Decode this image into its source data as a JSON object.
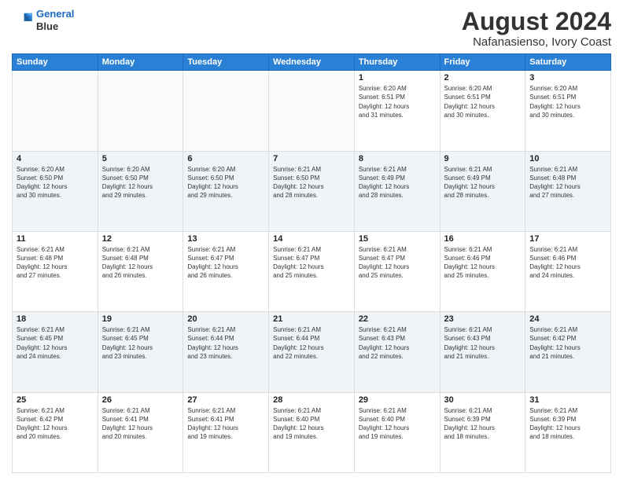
{
  "header": {
    "logo_line1": "General",
    "logo_line2": "Blue",
    "title": "August 2024",
    "subtitle": "Nafanasienso, Ivory Coast"
  },
  "weekdays": [
    "Sunday",
    "Monday",
    "Tuesday",
    "Wednesday",
    "Thursday",
    "Friday",
    "Saturday"
  ],
  "weeks": [
    [
      {
        "day": "",
        "info": ""
      },
      {
        "day": "",
        "info": ""
      },
      {
        "day": "",
        "info": ""
      },
      {
        "day": "",
        "info": ""
      },
      {
        "day": "1",
        "info": "Sunrise: 6:20 AM\nSunset: 6:51 PM\nDaylight: 12 hours\nand 31 minutes."
      },
      {
        "day": "2",
        "info": "Sunrise: 6:20 AM\nSunset: 6:51 PM\nDaylight: 12 hours\nand 30 minutes."
      },
      {
        "day": "3",
        "info": "Sunrise: 6:20 AM\nSunset: 6:51 PM\nDaylight: 12 hours\nand 30 minutes."
      }
    ],
    [
      {
        "day": "4",
        "info": "Sunrise: 6:20 AM\nSunset: 6:50 PM\nDaylight: 12 hours\nand 30 minutes."
      },
      {
        "day": "5",
        "info": "Sunrise: 6:20 AM\nSunset: 6:50 PM\nDaylight: 12 hours\nand 29 minutes."
      },
      {
        "day": "6",
        "info": "Sunrise: 6:20 AM\nSunset: 6:50 PM\nDaylight: 12 hours\nand 29 minutes."
      },
      {
        "day": "7",
        "info": "Sunrise: 6:21 AM\nSunset: 6:50 PM\nDaylight: 12 hours\nand 28 minutes."
      },
      {
        "day": "8",
        "info": "Sunrise: 6:21 AM\nSunset: 6:49 PM\nDaylight: 12 hours\nand 28 minutes."
      },
      {
        "day": "9",
        "info": "Sunrise: 6:21 AM\nSunset: 6:49 PM\nDaylight: 12 hours\nand 28 minutes."
      },
      {
        "day": "10",
        "info": "Sunrise: 6:21 AM\nSunset: 6:48 PM\nDaylight: 12 hours\nand 27 minutes."
      }
    ],
    [
      {
        "day": "11",
        "info": "Sunrise: 6:21 AM\nSunset: 6:48 PM\nDaylight: 12 hours\nand 27 minutes."
      },
      {
        "day": "12",
        "info": "Sunrise: 6:21 AM\nSunset: 6:48 PM\nDaylight: 12 hours\nand 26 minutes."
      },
      {
        "day": "13",
        "info": "Sunrise: 6:21 AM\nSunset: 6:47 PM\nDaylight: 12 hours\nand 26 minutes."
      },
      {
        "day": "14",
        "info": "Sunrise: 6:21 AM\nSunset: 6:47 PM\nDaylight: 12 hours\nand 25 minutes."
      },
      {
        "day": "15",
        "info": "Sunrise: 6:21 AM\nSunset: 6:47 PM\nDaylight: 12 hours\nand 25 minutes."
      },
      {
        "day": "16",
        "info": "Sunrise: 6:21 AM\nSunset: 6:46 PM\nDaylight: 12 hours\nand 25 minutes."
      },
      {
        "day": "17",
        "info": "Sunrise: 6:21 AM\nSunset: 6:46 PM\nDaylight: 12 hours\nand 24 minutes."
      }
    ],
    [
      {
        "day": "18",
        "info": "Sunrise: 6:21 AM\nSunset: 6:45 PM\nDaylight: 12 hours\nand 24 minutes."
      },
      {
        "day": "19",
        "info": "Sunrise: 6:21 AM\nSunset: 6:45 PM\nDaylight: 12 hours\nand 23 minutes."
      },
      {
        "day": "20",
        "info": "Sunrise: 6:21 AM\nSunset: 6:44 PM\nDaylight: 12 hours\nand 23 minutes."
      },
      {
        "day": "21",
        "info": "Sunrise: 6:21 AM\nSunset: 6:44 PM\nDaylight: 12 hours\nand 22 minutes."
      },
      {
        "day": "22",
        "info": "Sunrise: 6:21 AM\nSunset: 6:43 PM\nDaylight: 12 hours\nand 22 minutes."
      },
      {
        "day": "23",
        "info": "Sunrise: 6:21 AM\nSunset: 6:43 PM\nDaylight: 12 hours\nand 21 minutes."
      },
      {
        "day": "24",
        "info": "Sunrise: 6:21 AM\nSunset: 6:42 PM\nDaylight: 12 hours\nand 21 minutes."
      }
    ],
    [
      {
        "day": "25",
        "info": "Sunrise: 6:21 AM\nSunset: 6:42 PM\nDaylight: 12 hours\nand 20 minutes."
      },
      {
        "day": "26",
        "info": "Sunrise: 6:21 AM\nSunset: 6:41 PM\nDaylight: 12 hours\nand 20 minutes."
      },
      {
        "day": "27",
        "info": "Sunrise: 6:21 AM\nSunset: 6:41 PM\nDaylight: 12 hours\nand 19 minutes."
      },
      {
        "day": "28",
        "info": "Sunrise: 6:21 AM\nSunset: 6:40 PM\nDaylight: 12 hours\nand 19 minutes."
      },
      {
        "day": "29",
        "info": "Sunrise: 6:21 AM\nSunset: 6:40 PM\nDaylight: 12 hours\nand 19 minutes."
      },
      {
        "day": "30",
        "info": "Sunrise: 6:21 AM\nSunset: 6:39 PM\nDaylight: 12 hours\nand 18 minutes."
      },
      {
        "day": "31",
        "info": "Sunrise: 6:21 AM\nSunset: 6:39 PM\nDaylight: 12 hours\nand 18 minutes."
      }
    ]
  ]
}
